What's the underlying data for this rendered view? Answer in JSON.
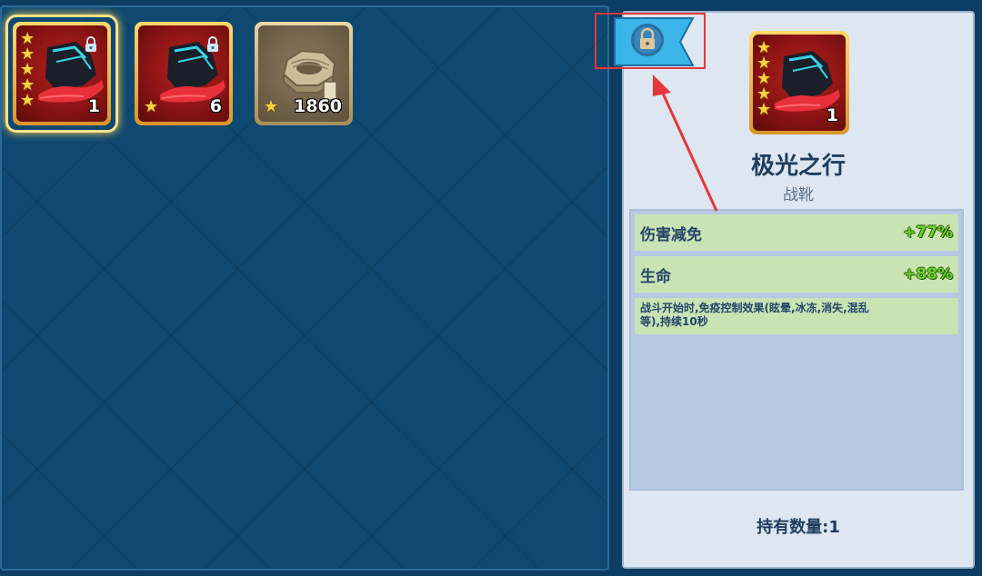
{
  "inventory": {
    "slots": [
      {
        "name": "shoe-item-selected",
        "stars": 5,
        "count": "1",
        "locked": true
      },
      {
        "name": "shoe-item",
        "stars": 1,
        "count": "6",
        "locked": true
      },
      {
        "name": "nut-material",
        "stars": 1,
        "count": "1860",
        "locked": false
      }
    ]
  },
  "lock_ribbon": {
    "icon": "lock-icon"
  },
  "detail": {
    "count": "1",
    "name": "极光之行",
    "type": "战靴",
    "stats": [
      {
        "label": "伤害减免",
        "value": "+77%"
      },
      {
        "label": "生命",
        "value": "+88%"
      }
    ],
    "description_line1": "战斗开始时,免疫控制效果(眩晕,冰冻,消失,混乱",
    "description_line2": "等),持续10秒",
    "owned": "持有数量:1"
  },
  "colors": {
    "accent_red": "#e5363a",
    "stat_green": "#6cd12a",
    "ribbon_blue": "#3bb4e8"
  }
}
